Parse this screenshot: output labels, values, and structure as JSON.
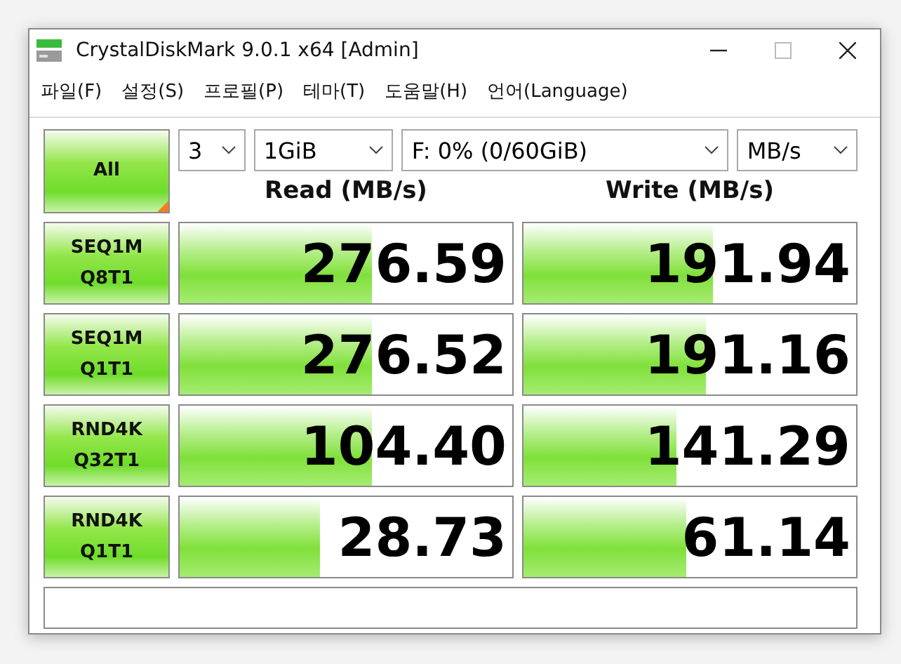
{
  "window": {
    "title": "CrystalDiskMark 9.0.1 x64 [Admin]"
  },
  "menu": [
    "파일(F)",
    "설정(S)",
    "프로필(P)",
    "테마(T)",
    "도움말(H)",
    "언어(Language)"
  ],
  "all_button": "All",
  "selectors": [
    {
      "value": "3"
    },
    {
      "value": "1GiB"
    },
    {
      "value": "F: 0% (0/60GiB)"
    },
    {
      "value": "MB/s"
    }
  ],
  "columns": [
    "Read (MB/s)",
    "Write (MB/s)"
  ],
  "tests": [
    {
      "type": "SEQ1M",
      "params": "Q8T1",
      "read": {
        "reading": "276.59",
        "level": 0.58
      },
      "write": {
        "reading": "191.94",
        "level": 0.57
      }
    },
    {
      "type": "SEQ1M",
      "params": "Q1T1",
      "read": {
        "reading": "276.52",
        "level": 0.58
      },
      "write": {
        "reading": "191.16",
        "level": 0.55
      }
    },
    {
      "type": "RND4K",
      "params": "Q32T1",
      "read": {
        "reading": "104.40",
        "level": 0.58
      },
      "write": {
        "reading": "141.29",
        "level": 0.46
      }
    },
    {
      "type": "RND4K",
      "params": "Q1T1",
      "read": {
        "reading": "28.73",
        "level": 0.42
      },
      "write": {
        "reading": "61.14",
        "level": 0.49
      }
    }
  ]
}
